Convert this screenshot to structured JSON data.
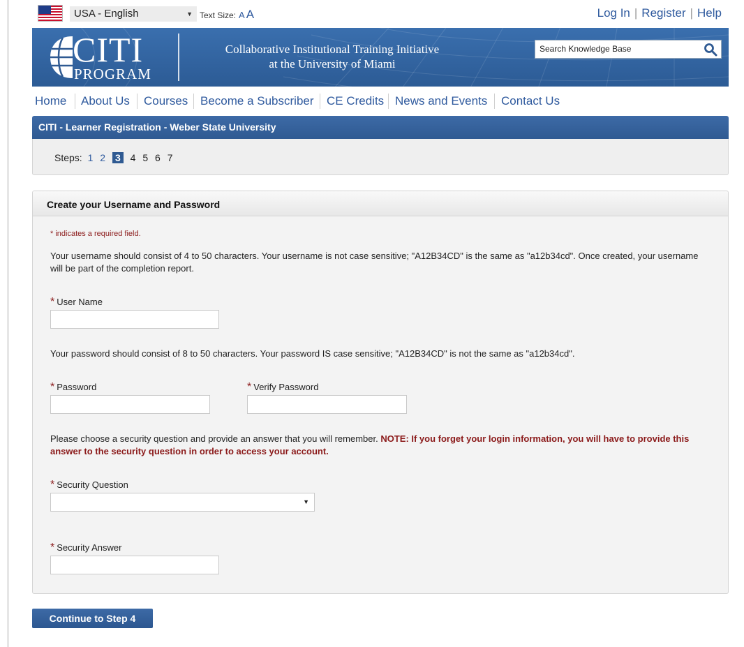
{
  "topbar": {
    "language": "USA - English",
    "text_size_label": "Text Size:",
    "text_size_small": "A",
    "text_size_large": "A",
    "login": "Log In",
    "register": "Register",
    "help": "Help"
  },
  "banner": {
    "logo_main": "CITI",
    "logo_sub": "PROGRAM",
    "tagline_line1": "Collaborative Institutional Training Initiative",
    "tagline_line2": "at the University of Miami",
    "search_placeholder": "Search Knowledge Base"
  },
  "nav": {
    "items": [
      "Home",
      "About Us",
      "Courses",
      "Become a Subscriber",
      "CE Credits",
      "News and Events",
      "Contact Us"
    ]
  },
  "registration": {
    "title": "CITI - Learner Registration - Weber State University",
    "steps_label": "Steps:",
    "steps": [
      "1",
      "2",
      "3",
      "4",
      "5",
      "6",
      "7"
    ],
    "current_step": 3
  },
  "form": {
    "title": "Create your Username and Password",
    "required_note": "* indicates a required field.",
    "username_help": "Your username should consist of 4 to 50 characters. Your username is not case sensitive; \"A12B34CD\" is the same as \"a12b34cd\". Once created, your username will be part of the completion report.",
    "username_label": "User Name",
    "username_value": "",
    "password_help": "Your password should consist of 8 to 50 characters. Your password IS case sensitive; \"A12B34CD\" is not the same as \"a12b34cd\".",
    "password_label": "Password",
    "password_value": "",
    "verify_label": "Verify Password",
    "verify_value": "",
    "security_help": "Please choose a security question and provide an answer that you will remember. ",
    "security_warning": "NOTE: If you forget your login information, you will have to provide this answer to the security question in order to access your account.",
    "question_label": "Security Question",
    "question_value": "",
    "answer_label": "Security Answer",
    "answer_value": "",
    "required_star": "*"
  },
  "continue_label": "Continue to Step 4",
  "colors": {
    "brand_blue": "#2f5a92",
    "link_blue": "#2f5a9e",
    "required_red": "#8b1a1a"
  }
}
